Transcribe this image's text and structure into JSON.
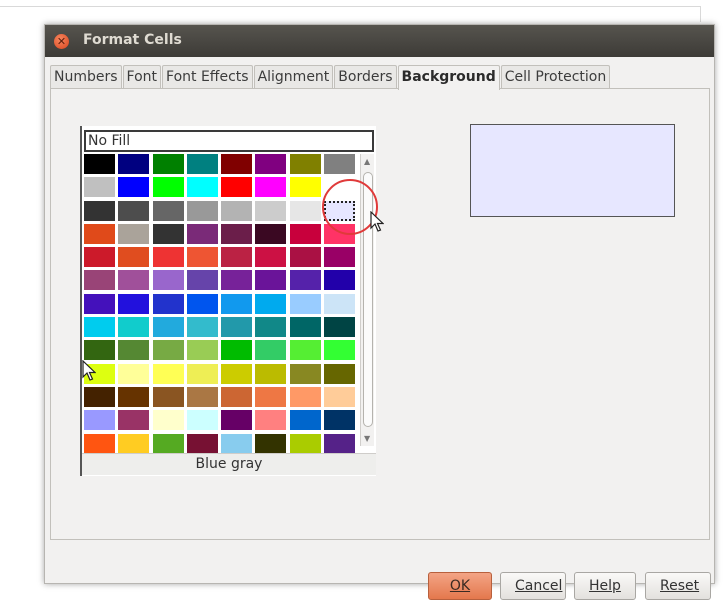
{
  "dialog": {
    "title": "Format Cells",
    "tabs": [
      {
        "label": "Numbers",
        "active": false
      },
      {
        "label": "Font",
        "active": false
      },
      {
        "label": "Font Effects",
        "active": false
      },
      {
        "label": "Alignment",
        "active": false
      },
      {
        "label": "Borders",
        "active": false
      },
      {
        "label": "Background",
        "active": true
      },
      {
        "label": "Cell Protection",
        "active": false
      }
    ],
    "background": {
      "no_fill_label": "No Fill",
      "selected_color_name": "Blue gray",
      "preview_color": "#e7e7ff",
      "selected_swatch": {
        "row": 2,
        "col": 7
      },
      "palette": [
        [
          "#000000",
          "#000080",
          "#008000",
          "#008080",
          "#800000",
          "#800080",
          "#808000",
          "#808080"
        ],
        [
          "#c0c0c0",
          "#0000ff",
          "#00ff00",
          "#00ffff",
          "#ff0000",
          "#ff00ff",
          "#ffff00",
          "#ffffff"
        ],
        [
          "#333333",
          "#4d4d4d",
          "#666666",
          "#999999",
          "#b3b3b3",
          "#cccccc",
          "#e6e6e6",
          "#e6e6ff"
        ],
        [
          "#e04a1a",
          "#aaa39a",
          "#333333",
          "#7a2a78",
          "#6b1e4a",
          "#3a0822",
          "#c8003c",
          "#ff3366"
        ],
        [
          "#cc1a2a",
          "#e04d1f",
          "#ee3333",
          "#ee5533",
          "#bb2244",
          "#cc1144",
          "#aa1144",
          "#990066"
        ],
        [
          "#994477",
          "#a0509a",
          "#9966cc",
          "#6644aa",
          "#772299",
          "#6a1499",
          "#5522aa",
          "#2200aa"
        ],
        [
          "#4411bb",
          "#2211dd",
          "#2233cc",
          "#0055ee",
          "#1199ee",
          "#00aaee",
          "#99ccff",
          "#cce4f7"
        ],
        [
          "#00ccee",
          "#11cccc",
          "#22aadd",
          "#33bbcc",
          "#2299aa",
          "#118888",
          "#006666",
          "#004444"
        ],
        [
          "#336611",
          "#558833",
          "#77aa44",
          "#99cc55",
          "#00bb00",
          "#33cc66",
          "#55ee33",
          "#33ff33"
        ],
        [
          "#ddff11",
          "#ffff99",
          "#ffff55",
          "#eeee55",
          "#cccc00",
          "#bbbb00",
          "#888822",
          "#666600"
        ],
        [
          "#442200",
          "#663300",
          "#8a5522",
          "#aa7744",
          "#cc6633",
          "#ee7744",
          "#ff9966",
          "#ffcc99"
        ],
        [
          "#9999ff",
          "#993366",
          "#ffffcc",
          "#ccffff",
          "#660066",
          "#ff8080",
          "#0066cc",
          "#003366"
        ],
        [
          "#ff5511",
          "#ffcc22",
          "#55aa22",
          "#771133",
          "#88ccee",
          "#333300",
          "#aacc00",
          "#552288"
        ]
      ]
    },
    "buttons": {
      "ok": "OK",
      "cancel": "Cancel",
      "help": "Help",
      "reset": "Reset"
    }
  },
  "icons": {
    "close": "close-icon",
    "cursor": "mouse-pointer-icon"
  }
}
